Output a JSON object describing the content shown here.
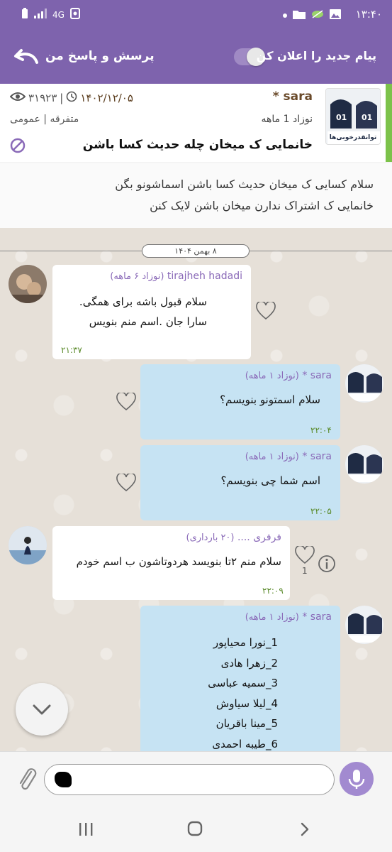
{
  "status_bar": {
    "time": "۱۳:۴۰",
    "network": "4G"
  },
  "app_bar": {
    "title": "پرسش و پاسخ من",
    "announce_label": "پیام جدید را اعلان کن",
    "toggle_on": false
  },
  "topic": {
    "author": "sara *",
    "date": "۱۴۰۲/۱۲/۰۵",
    "views": "۳۱۹۲۳",
    "separator": "|",
    "age": "نوزاد 1 ماهه",
    "category": "متفرقه | عمومی",
    "title": "خانمایی ک میخان چله حدیث کسا باشن",
    "thumb_text": "توانقدرخوبی‌ها",
    "body_line1": "سلام کسایی ک میخان حدیث کسا باشن اسماشونو بگن",
    "body_line2": "خانمایی ک اشتراک ندارن میخان باشن لایک کنن"
  },
  "chat": {
    "date_chip": "۸ بهمن ۱۴۰۴",
    "messages": [
      {
        "name": "tirajheh hadadi",
        "sub": "(نوزاد ۶ ماهه)",
        "line1": "سلام  قبول باشه برای همگی.",
        "line2": "سارا جان .اسم منم بنویس",
        "time": "۲۱:۳۷"
      },
      {
        "name": "sara *",
        "sub": "(نوزاد ۱ ماهه)",
        "line1": "سلام اسمتونو بنویسم؟",
        "time": "۲۲:۰۴"
      },
      {
        "name": "sara *",
        "sub": "(نوزاد ۱ ماهه)",
        "line1": "اسم شما چی بنویسم؟",
        "time": "۲۲:۰۵"
      },
      {
        "name": "فرفری ....",
        "sub": "(۲۰ بارداری)",
        "line1": "سلام منم ۲تا بنویسد هردوتاشون ب اسم خودم",
        "time": "۲۲:۰۹",
        "likes": "1"
      },
      {
        "name": "sara *",
        "sub": "(نوزاد ۱ ماهه)",
        "list": [
          "1_نورا محیاپور",
          "2_زهرا هادی",
          "3_سمیه عباسی",
          "4_لیلا سیاوش",
          "5_مینا باقریان",
          "6_طیبه احمدی"
        ]
      }
    ]
  },
  "colors": {
    "primary": "#7e63ad",
    "accent_green": "#7cc24a",
    "bubble_blue": "#c6e3f3",
    "name_purple": "#8a6ab8",
    "time_green": "#5a8a2a"
  }
}
